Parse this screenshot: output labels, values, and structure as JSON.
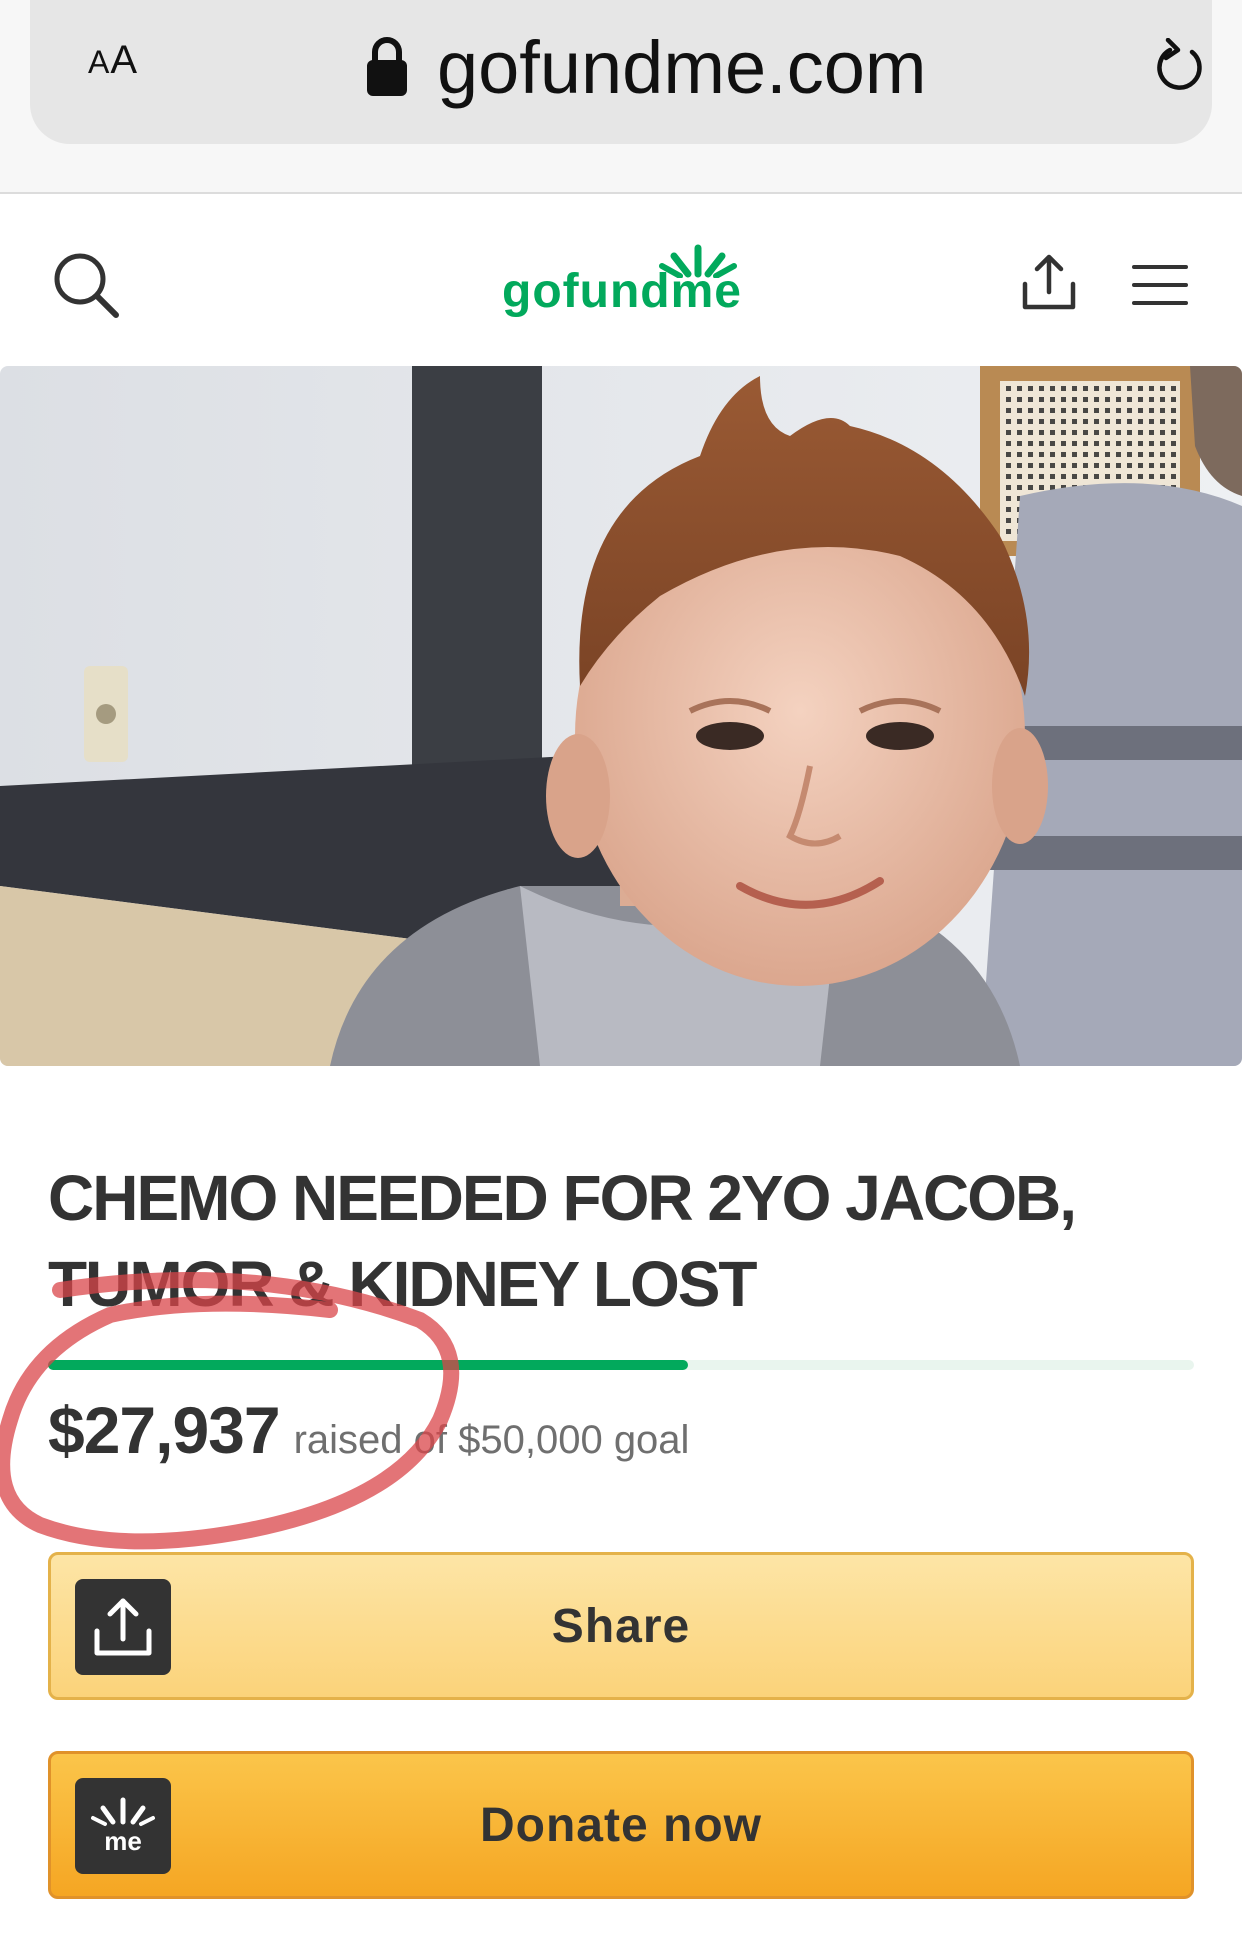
{
  "browser": {
    "text_size_label_small": "A",
    "text_size_label_large": "A",
    "url": "gofundme.com"
  },
  "header": {
    "logo_text_a": "gofund",
    "logo_text_b": "me"
  },
  "campaign": {
    "title_line1": "CHEMO NEEDED FOR 2YO JACOB,",
    "title_line2": "TUMOR & KIDNEY LOST",
    "raised": "$27,937",
    "goal_text": "raised of $50,000 goal",
    "progress_fraction": 0.5587
  },
  "actions": {
    "share_label": "Share",
    "donate_label": "Donate now",
    "donate_badge_text": "me"
  },
  "colors": {
    "brand_green": "#02a95c",
    "share_button": "#fbd37a",
    "donate_button": "#f5a623",
    "annotation_red": "#d9454a"
  }
}
